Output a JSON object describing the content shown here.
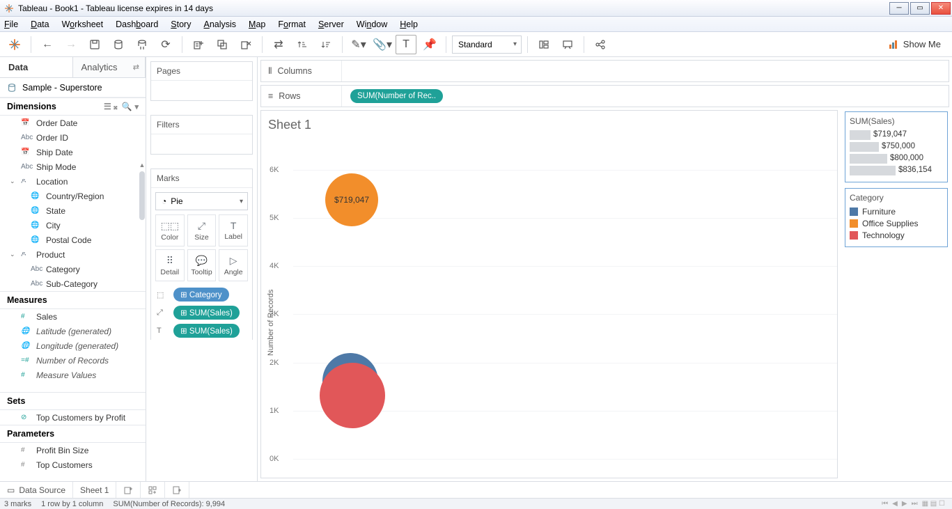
{
  "title": "Tableau - Book1 - Tableau license expires in 14 days",
  "menu": {
    "file": "File",
    "data": "Data",
    "worksheet": "Worksheet",
    "dashboard": "Dashboard",
    "story": "Story",
    "analysis": "Analysis",
    "map": "Map",
    "format": "Format",
    "server": "Server",
    "window": "Window",
    "help": "Help"
  },
  "toolbar": {
    "fit": "Standard",
    "showme": "Show Me"
  },
  "left": {
    "tab_data": "Data",
    "tab_analytics": "Analytics",
    "datasource": "Sample - Superstore",
    "dimensions": "Dimensions",
    "dim_items": [
      {
        "icon": "date",
        "label": "Order Date"
      },
      {
        "icon": "abc",
        "label": "Order ID"
      },
      {
        "icon": "date",
        "label": "Ship Date"
      },
      {
        "icon": "abc",
        "label": "Ship Mode"
      }
    ],
    "loc_label": "Location",
    "loc_items": [
      {
        "icon": "globe",
        "label": "Country/Region"
      },
      {
        "icon": "globe",
        "label": "State"
      },
      {
        "icon": "globe",
        "label": "City"
      },
      {
        "icon": "globe",
        "label": "Postal Code"
      }
    ],
    "prod_label": "Product",
    "prod_items": [
      {
        "icon": "abc",
        "label": "Category"
      },
      {
        "icon": "abc",
        "label": "Sub-Category"
      }
    ],
    "measures": "Measures",
    "meas_items": [
      {
        "icon": "hash",
        "label": "Sales",
        "gen": false
      },
      {
        "icon": "globe",
        "label": "Latitude (generated)",
        "gen": true
      },
      {
        "icon": "globe",
        "label": "Longitude (generated)",
        "gen": true
      },
      {
        "icon": "nhash",
        "label": "Number of Records",
        "gen": true
      },
      {
        "icon": "hash",
        "label": "Measure Values",
        "gen": true
      }
    ],
    "sets": "Sets",
    "set_items": [
      {
        "label": "Top Customers by Profit"
      }
    ],
    "parameters": "Parameters",
    "param_items": [
      {
        "label": "Profit Bin Size"
      },
      {
        "label": "Top Customers"
      }
    ]
  },
  "cards": {
    "pages": "Pages",
    "filters": "Filters",
    "marks": "Marks",
    "mark_type": "Pie",
    "cells": {
      "color": "Color",
      "size": "Size",
      "label": "Label",
      "detail": "Detail",
      "tooltip": "Tooltip",
      "angle": "Angle"
    },
    "pills": [
      {
        "icon": "color",
        "label": "Category",
        "class": "blue"
      },
      {
        "icon": "size",
        "label": "SUM(Sales)",
        "class": "teal"
      },
      {
        "icon": "label",
        "label": "SUM(Sales)",
        "class": "teal"
      }
    ]
  },
  "shelves": {
    "columns": "Columns",
    "rows": "Rows",
    "row_pill": "SUM(Number of Rec.."
  },
  "sheet": {
    "title": "Sheet 1",
    "ylabel": "Number of Records",
    "label1": "$719,047"
  },
  "legends": {
    "size_title": "SUM(Sales)",
    "size_values": [
      "$719,047",
      "$750,000",
      "$800,000",
      "$836,154"
    ],
    "cat_title": "Category",
    "cats": [
      {
        "color": "#4e79a7",
        "label": "Furniture"
      },
      {
        "color": "#f28e2b",
        "label": "Office Supplies"
      },
      {
        "color": "#e15759",
        "label": "Technology"
      }
    ]
  },
  "tabs": {
    "datasource": "Data Source",
    "sheet1": "Sheet 1"
  },
  "status": {
    "marks": "3 marks",
    "rowcol": "1 row by 1 column",
    "sum": "SUM(Number of Records): 9,994"
  },
  "chart_data": {
    "type": "scatter",
    "ylabel": "Number of Records",
    "ylim": [
      0,
      6500
    ],
    "yticks": [
      0,
      1000,
      2000,
      3000,
      4000,
      5000,
      6000
    ],
    "ytick_labels": [
      "0K",
      "1K",
      "2K",
      "3K",
      "4K",
      "5K",
      "6K"
    ],
    "series": [
      {
        "name": "Office Supplies",
        "y": 6000,
        "size": 719047,
        "color": "#f28e2b",
        "label": "$719,047"
      },
      {
        "name": "Furniture",
        "y": 2100,
        "size": 742000,
        "color": "#4e79a7"
      },
      {
        "name": "Technology",
        "y": 1850,
        "size": 836154,
        "color": "#e15759"
      }
    ],
    "size_legend": {
      "title": "SUM(Sales)",
      "range": [
        719047,
        836154
      ]
    }
  }
}
